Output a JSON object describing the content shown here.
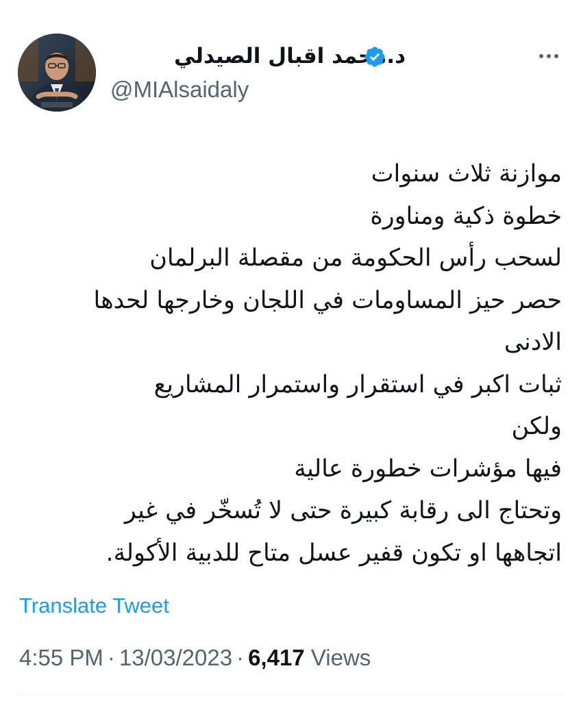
{
  "author": {
    "display_name": "د.محمد اقبال الصيدلي",
    "handle": "@MIAlsaidaly",
    "verified": true,
    "avatar_icon": "profile-photo"
  },
  "tweet": {
    "lines": [
      "موازنة ثلاث سنوات",
      "خطوة ذكية ومناورة",
      "لسحب رأس الحكومة من مقصلة البرلمان",
      "حصر حيز المساومات في اللجان وخارجها لحدها",
      "الادنى",
      "ثبات اكبر في استقرار واستمرار المشاريع",
      "ولكن",
      "فيها مؤشرات خطورة عالية",
      "وتحتاج الى رقابة كبيرة حتى لا تُسخّر في غير",
      "اتجاهها او تكون قفير عسل متاح للدبية الأكولة."
    ]
  },
  "translate_label": "Translate Tweet",
  "meta": {
    "time": "4:55 PM",
    "separator": "·",
    "date": "13/03/2023",
    "views_count": "6,417",
    "views_label": "Views"
  },
  "colors": {
    "accent": "#1d9bf0",
    "secondary_text": "#536471",
    "primary_text": "#0f1419",
    "verified_badge": "#1d9bf0"
  }
}
